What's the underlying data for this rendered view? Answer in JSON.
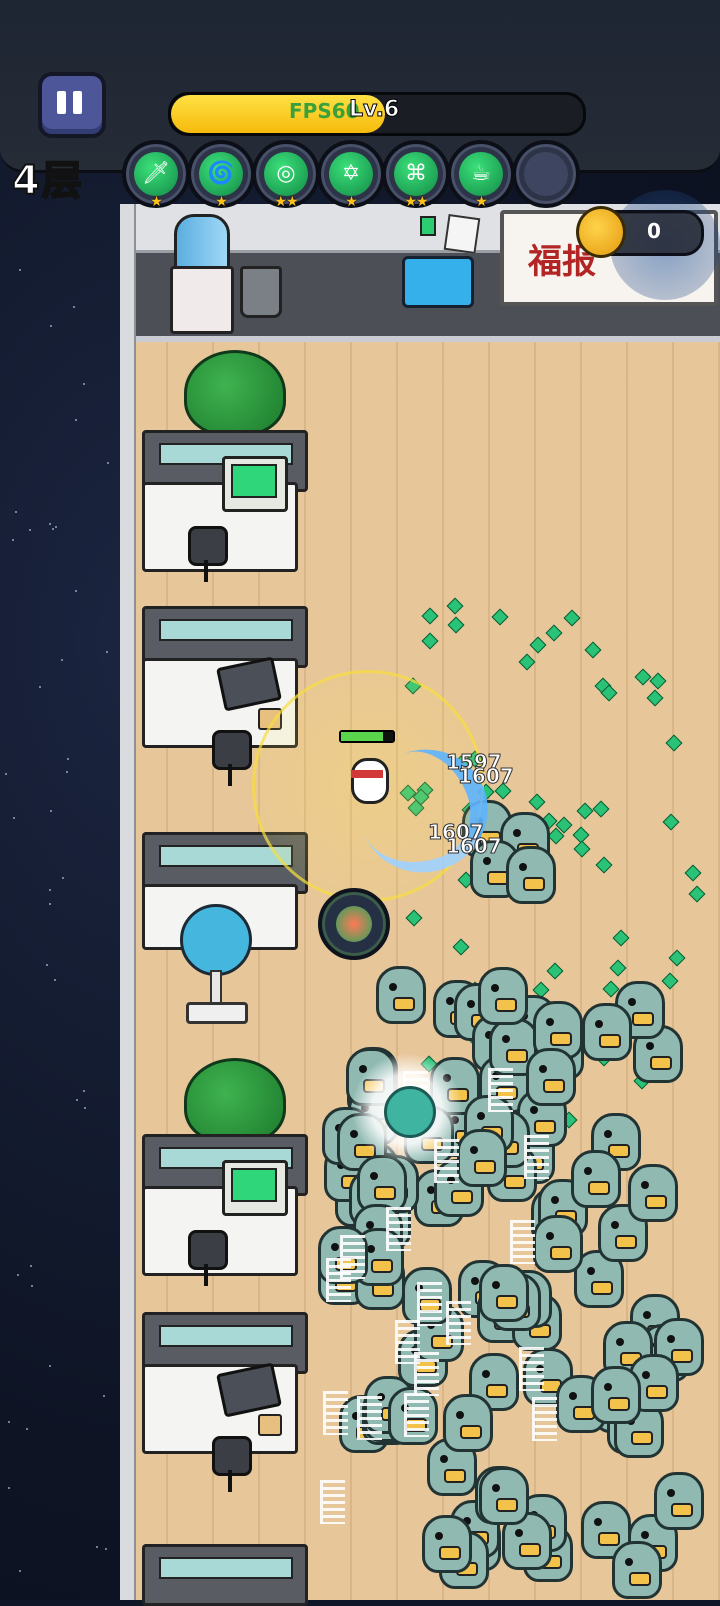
{
  "hud": {
    "floor_label": "4层",
    "fps_label": "FPS60",
    "level_label": "Lv.6",
    "xp_progress": 0.52,
    "coins": "0"
  },
  "skills": [
    {
      "icon": "sword-icon",
      "stars": "★",
      "color": "#2ecc71"
    },
    {
      "icon": "tornado-icon",
      "stars": "★",
      "color": "#2ecc71"
    },
    {
      "icon": "target-icon",
      "stars": "★★",
      "color": "#2ecc71"
    },
    {
      "icon": "hexagram-icon",
      "stars": "★",
      "color": "#2ecc71"
    },
    {
      "icon": "tape-icon",
      "stars": "★★",
      "color": "#2ecc71"
    },
    {
      "icon": "mug-icon",
      "stars": "★",
      "color": "#2ecc71"
    },
    {
      "icon": "empty-slot-icon",
      "stars": "",
      "color": "#3d4560"
    }
  ],
  "office": {
    "sign_text": "福报"
  },
  "combat": {
    "damage_numbers": [
      "1597",
      "1607",
      "1607",
      "1607"
    ]
  },
  "colors": {
    "xp_fill": "#f6c519",
    "hp_fill": "#59d64c",
    "gem": "#29c276",
    "zombie": "#8fb9b1"
  }
}
